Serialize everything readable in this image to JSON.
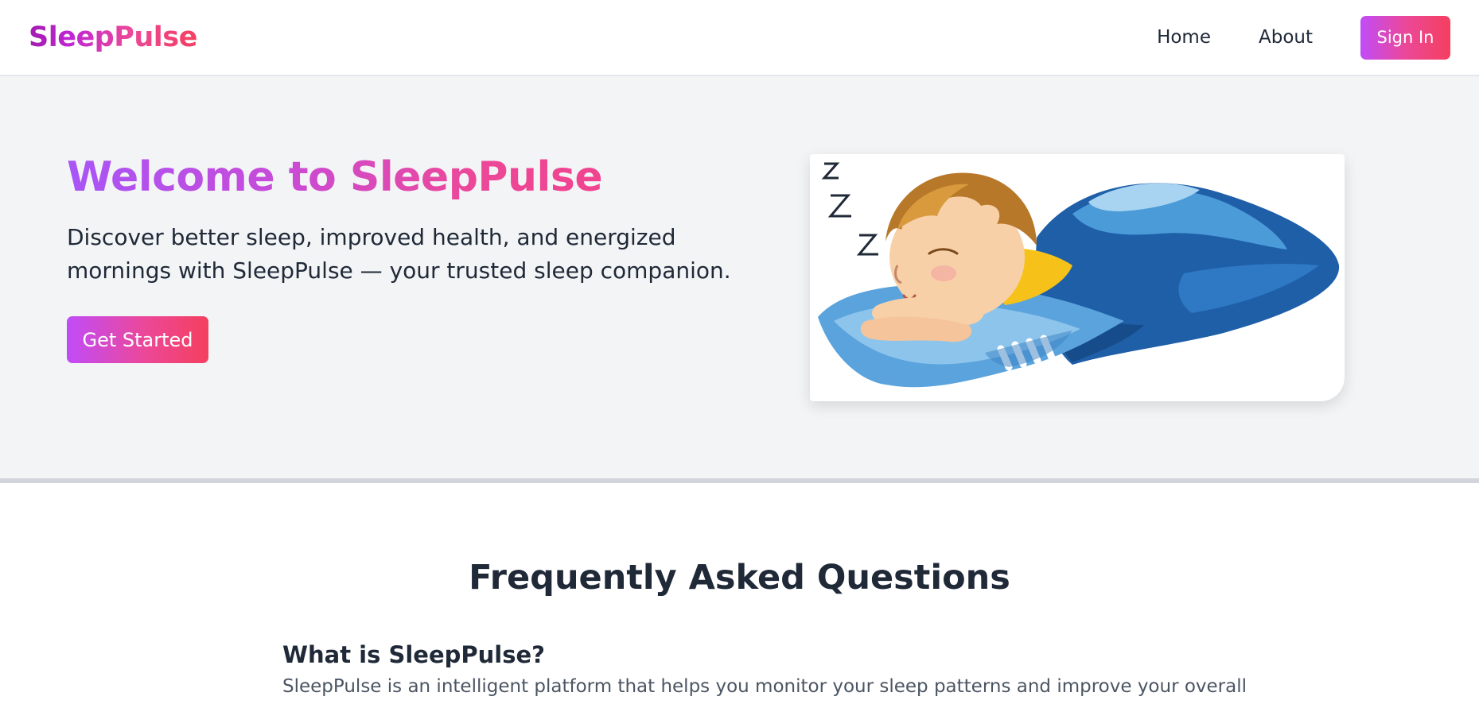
{
  "header": {
    "logo": "SleepPulse",
    "nav": [
      "Home",
      "About"
    ],
    "signin_label": "Sign In"
  },
  "hero": {
    "title": "Welcome to SleepPulse",
    "subtitle": "Discover better sleep, improved health, and energized mornings with SleepPulse — your trusted sleep companion.",
    "cta_label": "Get Started",
    "image": "sleeping-child-illustration"
  },
  "faq": {
    "title": "Frequently Asked Questions",
    "items": [
      {
        "question": "What is SleepPulse?",
        "answer": "SleepPulse is an intelligent platform that helps you monitor your sleep patterns and improve your overall"
      }
    ]
  },
  "colors": {
    "brand_gradient_start": "#a855f7",
    "brand_gradient_end": "#f43f5e",
    "hero_bg": "#f3f4f6",
    "text_dark": "#1f2937"
  }
}
